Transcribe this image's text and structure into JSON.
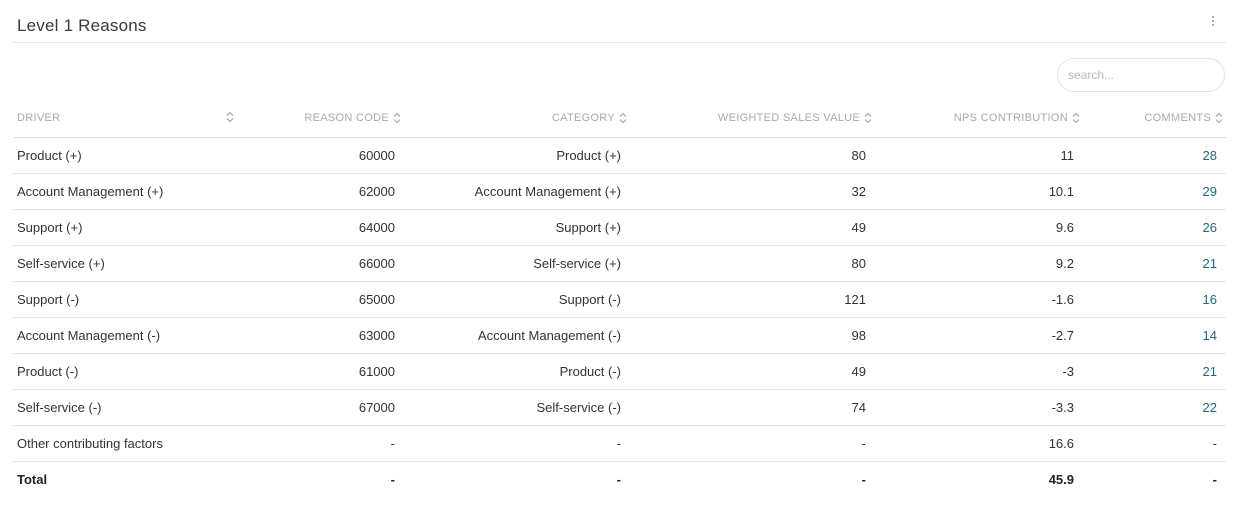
{
  "panel": {
    "title": "Level 1 Reasons"
  },
  "search": {
    "placeholder": "search..."
  },
  "columns": [
    "DRIVER",
    "REASON CODE",
    "CATEGORY",
    "WEIGHTED SALES VALUE",
    "NPS CONTRIBUTION",
    "COMMENTS"
  ],
  "rows": [
    {
      "driver": "Product (+)",
      "code": "60000",
      "category": "Product (+)",
      "wsv": "80",
      "nps": "11",
      "comments": "28"
    },
    {
      "driver": "Account Management (+)",
      "code": "62000",
      "category": "Account Management (+)",
      "wsv": "32",
      "nps": "10.1",
      "comments": "29"
    },
    {
      "driver": "Support (+)",
      "code": "64000",
      "category": "Support (+)",
      "wsv": "49",
      "nps": "9.6",
      "comments": "26"
    },
    {
      "driver": "Self-service (+)",
      "code": "66000",
      "category": "Self-service (+)",
      "wsv": "80",
      "nps": "9.2",
      "comments": "21"
    },
    {
      "driver": "Support (-)",
      "code": "65000",
      "category": "Support (-)",
      "wsv": "121",
      "nps": "-1.6",
      "comments": "16"
    },
    {
      "driver": "Account Management (-)",
      "code": "63000",
      "category": "Account Management (-)",
      "wsv": "98",
      "nps": "-2.7",
      "comments": "14"
    },
    {
      "driver": "Product (-)",
      "code": "61000",
      "category": "Product (-)",
      "wsv": "49",
      "nps": "-3",
      "comments": "21"
    },
    {
      "driver": "Self-service (-)",
      "code": "67000",
      "category": "Self-service (-)",
      "wsv": "74",
      "nps": "-3.3",
      "comments": "22"
    },
    {
      "driver": "Other contributing factors",
      "code": "-",
      "category": "-",
      "wsv": "-",
      "nps": "16.6",
      "comments": "-"
    }
  ],
  "total": {
    "driver": "Total",
    "code": "-",
    "category": "-",
    "wsv": "-",
    "nps": "45.9",
    "comments": "-"
  },
  "colors": {
    "link": "#1d6b7c",
    "header_text": "#a9a9a9",
    "row_border": "#e4e4e4"
  }
}
